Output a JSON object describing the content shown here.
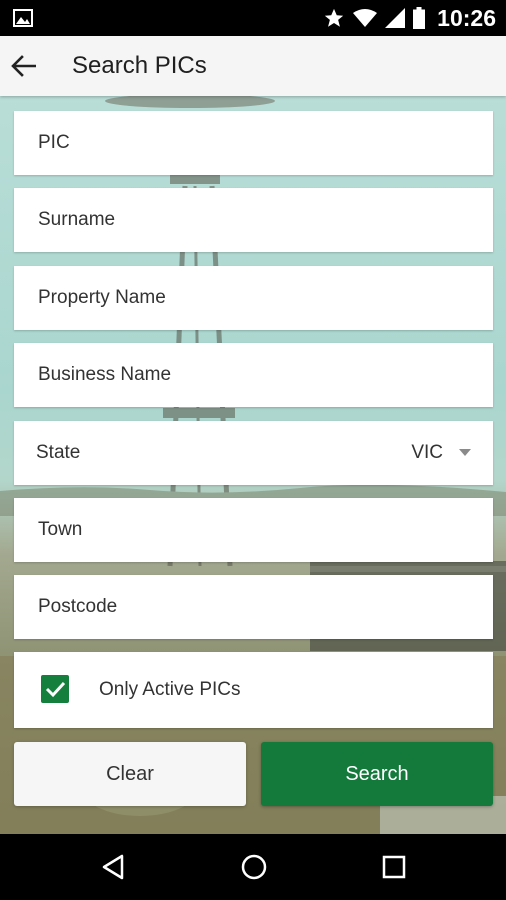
{
  "status_bar": {
    "time": "10:26",
    "icons": [
      "gallery-icon",
      "star-icon",
      "wifi-icon",
      "signal-icon",
      "battery-icon"
    ]
  },
  "app_bar": {
    "title": "Search PICs",
    "back_icon": "arrow-left-icon"
  },
  "form": {
    "pic_placeholder": "PIC",
    "surname_placeholder": "Surname",
    "property_name_placeholder": "Property Name",
    "business_name_placeholder": "Business Name",
    "state_label": "State",
    "state_value": "VIC",
    "town_placeholder": "Town",
    "postcode_placeholder": "Postcode",
    "only_active_label": "Only Active PICs",
    "only_active_checked": true
  },
  "buttons": {
    "clear_label": "Clear",
    "search_label": "Search"
  },
  "colors": {
    "accent": "#137a3c",
    "checkbox": "#15803d",
    "app_bar": "#f5f5f5"
  },
  "nav_bar": {
    "icons": [
      "back-triangle-icon",
      "home-circle-icon",
      "recents-square-icon"
    ]
  }
}
